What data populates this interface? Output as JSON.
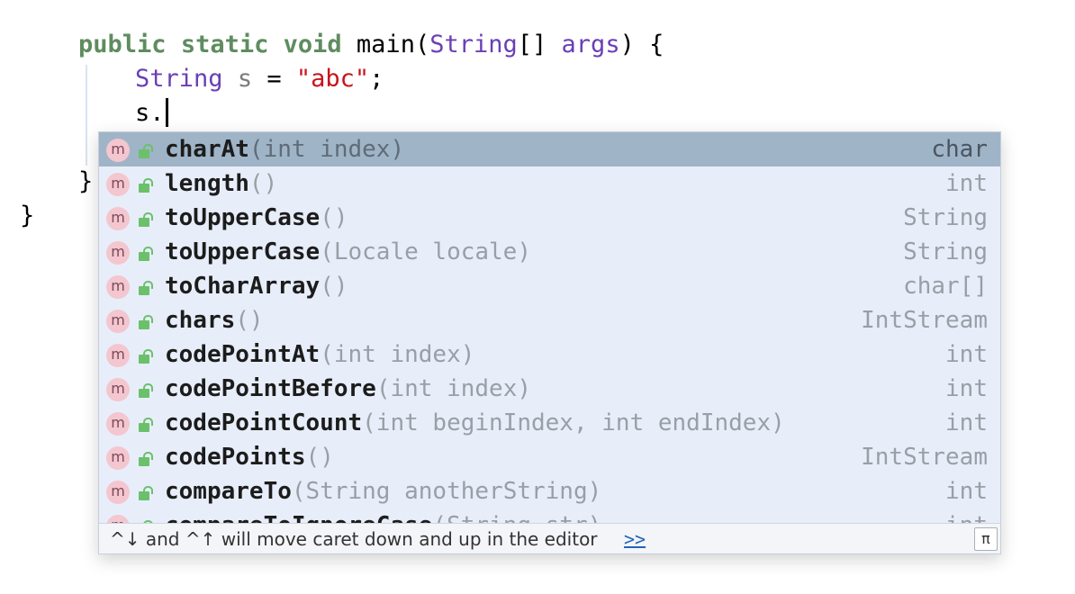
{
  "editor": {
    "line1": {
      "public": "public",
      "static": "static",
      "void": "void",
      "method": "main",
      "paren_open": "(",
      "param_type": "String",
      "brackets": "[]",
      "param_name": "args",
      "tail": ") {"
    },
    "line2": {
      "type": "String",
      "var": "s",
      "op": "=",
      "literal": "\"abc\"",
      "semi": ";"
    },
    "line3": {
      "text": "s."
    },
    "line4": {
      "brace": "}"
    },
    "line5": {
      "brace": "}"
    }
  },
  "completion": {
    "items": [
      {
        "name": "charAt",
        "params": "(int index)",
        "return": "char"
      },
      {
        "name": "length",
        "params": "()",
        "return": "int"
      },
      {
        "name": "toUpperCase",
        "params": "()",
        "return": "String"
      },
      {
        "name": "toUpperCase",
        "params": "(Locale locale)",
        "return": "String"
      },
      {
        "name": "toCharArray",
        "params": "()",
        "return": "char[]"
      },
      {
        "name": "chars",
        "params": "()",
        "return": "IntStream"
      },
      {
        "name": "codePointAt",
        "params": "(int index)",
        "return": "int"
      },
      {
        "name": "codePointBefore",
        "params": "(int index)",
        "return": "int"
      },
      {
        "name": "codePointCount",
        "params": "(int beginIndex, int endIndex)",
        "return": "int"
      },
      {
        "name": "codePoints",
        "params": "()",
        "return": "IntStream"
      },
      {
        "name": "compareTo",
        "params": "(String anotherString)",
        "return": "int"
      },
      {
        "name": "compareToIgnoreCase",
        "params": "(String str)",
        "return": "int"
      }
    ],
    "selected_index": 0,
    "item_icon_letter": "m",
    "footer": {
      "hint": "^↓ and ^↑ will move caret down and up in the editor",
      "link": ">>",
      "pi": "π"
    }
  },
  "colors": {
    "keyword": "#5f8c5f",
    "type": "#6a3fb5",
    "string": "#c8141e",
    "selected_row": "#9fb4c7",
    "popup_bg": "#e7eef9"
  }
}
